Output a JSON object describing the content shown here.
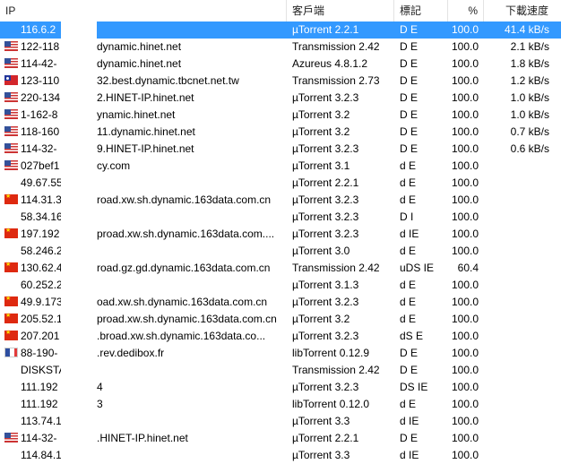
{
  "columns": {
    "ip": "IP",
    "client": "客戶端",
    "flags": "標記",
    "percent": "%",
    "down_speed": "下載速度"
  },
  "peers": [
    {
      "flag": "none",
      "ip": "116.6.2",
      "host": "",
      "client": "µTorrent 2.2.1",
      "flags": "D E",
      "percent": "100.0",
      "down": "41.4 kB/s",
      "selected": true
    },
    {
      "flag": "us",
      "ip": "122-118",
      "host": "dynamic.hinet.net",
      "client": "Transmission 2.42",
      "flags": "D E",
      "percent": "100.0",
      "down": "2.1 kB/s"
    },
    {
      "flag": "us",
      "ip": "114-42-",
      "host": "dynamic.hinet.net",
      "client": "Azureus 4.8.1.2",
      "flags": "D E",
      "percent": "100.0",
      "down": "1.8 kB/s"
    },
    {
      "flag": "tw",
      "ip": "123-110",
      "host": "32.best.dynamic.tbcnet.net.tw",
      "client": "Transmission 2.73",
      "flags": "D E",
      "percent": "100.0",
      "down": "1.2 kB/s"
    },
    {
      "flag": "us",
      "ip": "220-134",
      "host": "2.HINET-IP.hinet.net",
      "client": "µTorrent 3.2.3",
      "flags": "D E",
      "percent": "100.0",
      "down": "1.0 kB/s"
    },
    {
      "flag": "us",
      "ip": "1-162-8",
      "host": "ynamic.hinet.net",
      "client": "µTorrent 3.2",
      "flags": "D E",
      "percent": "100.0",
      "down": "1.0 kB/s"
    },
    {
      "flag": "us",
      "ip": "118-160",
      "host": "11.dynamic.hinet.net",
      "client": "µTorrent 3.2",
      "flags": "D E",
      "percent": "100.0",
      "down": "0.7 kB/s"
    },
    {
      "flag": "us",
      "ip": "114-32-",
      "host": "9.HINET-IP.hinet.net",
      "client": "µTorrent 3.2.3",
      "flags": "D E",
      "percent": "100.0",
      "down": "0.6 kB/s"
    },
    {
      "flag": "us",
      "ip": "027bef1",
      "host": "cy.com",
      "client": "µTorrent 3.1",
      "flags": "d E",
      "percent": "100.0",
      "down": ""
    },
    {
      "flag": "none",
      "ip": "49.67.55",
      "host": "",
      "client": "µTorrent 2.2.1",
      "flags": "d E",
      "percent": "100.0",
      "down": ""
    },
    {
      "flag": "cn",
      "ip": "114.31.3",
      "host": "road.xw.sh.dynamic.163data.com.cn",
      "client": "µTorrent 3.2.3",
      "flags": "d E",
      "percent": "100.0",
      "down": ""
    },
    {
      "flag": "none",
      "ip": "58.34.16",
      "host": "",
      "client": "µTorrent 3.2.3",
      "flags": "D I",
      "percent": "100.0",
      "down": ""
    },
    {
      "flag": "cn",
      "ip": "197.192",
      "host": "proad.xw.sh.dynamic.163data.com....",
      "client": "µTorrent 3.2.3",
      "flags": "d IE",
      "percent": "100.0",
      "down": ""
    },
    {
      "flag": "none",
      "ip": "58.246.2",
      "host": "",
      "client": "µTorrent 3.0",
      "flags": "d E",
      "percent": "100.0",
      "down": ""
    },
    {
      "flag": "cn",
      "ip": "130.62.4",
      "host": "road.gz.gd.dynamic.163data.com.cn",
      "client": "Transmission 2.42",
      "flags": "uDS IE",
      "percent": "60.4",
      "down": ""
    },
    {
      "flag": "none",
      "ip": "60.252.2",
      "host": "",
      "client": "µTorrent 3.1.3",
      "flags": "d E",
      "percent": "100.0",
      "down": ""
    },
    {
      "flag": "cn",
      "ip": "49.9.173",
      "host": "oad.xw.sh.dynamic.163data.com.cn",
      "client": "µTorrent 3.2.3",
      "flags": "d E",
      "percent": "100.0",
      "down": ""
    },
    {
      "flag": "cn",
      "ip": "205.52.1",
      "host": "proad.xw.sh.dynamic.163data.com.cn",
      "client": "µTorrent 3.2",
      "flags": "d E",
      "percent": "100.0",
      "down": ""
    },
    {
      "flag": "cn",
      "ip": "207.201",
      "host": ".broad.xw.sh.dynamic.163data.co...",
      "client": "µTorrent 3.2.3",
      "flags": "dS E",
      "percent": "100.0",
      "down": ""
    },
    {
      "flag": "fr",
      "ip": "88-190-",
      "host": ".rev.dedibox.fr",
      "client": "libTorrent 0.12.9",
      "flags": "D E",
      "percent": "100.0",
      "down": ""
    },
    {
      "flag": "none",
      "ip": "DISKSTA",
      "host": "",
      "client": "Transmission 2.42",
      "flags": "D E",
      "percent": "100.0",
      "down": ""
    },
    {
      "flag": "none",
      "ip": "111.192",
      "host": "4",
      "client": "µTorrent 3.2.3",
      "flags": "DS IE",
      "percent": "100.0",
      "down": ""
    },
    {
      "flag": "none",
      "ip": "111.192",
      "host": "3",
      "client": "libTorrent 0.12.0",
      "flags": "d E",
      "percent": "100.0",
      "down": ""
    },
    {
      "flag": "none",
      "ip": "113.74.1",
      "host": "",
      "client": "µTorrent 3.3",
      "flags": "d IE",
      "percent": "100.0",
      "down": ""
    },
    {
      "flag": "us",
      "ip": "114-32-",
      "host": ".HINET-IP.hinet.net",
      "client": "µTorrent 2.2.1",
      "flags": "D E",
      "percent": "100.0",
      "down": ""
    },
    {
      "flag": "none",
      "ip": "114.84.1",
      "host": "",
      "client": "µTorrent 3.3",
      "flags": "d IE",
      "percent": "100.0",
      "down": ""
    }
  ]
}
